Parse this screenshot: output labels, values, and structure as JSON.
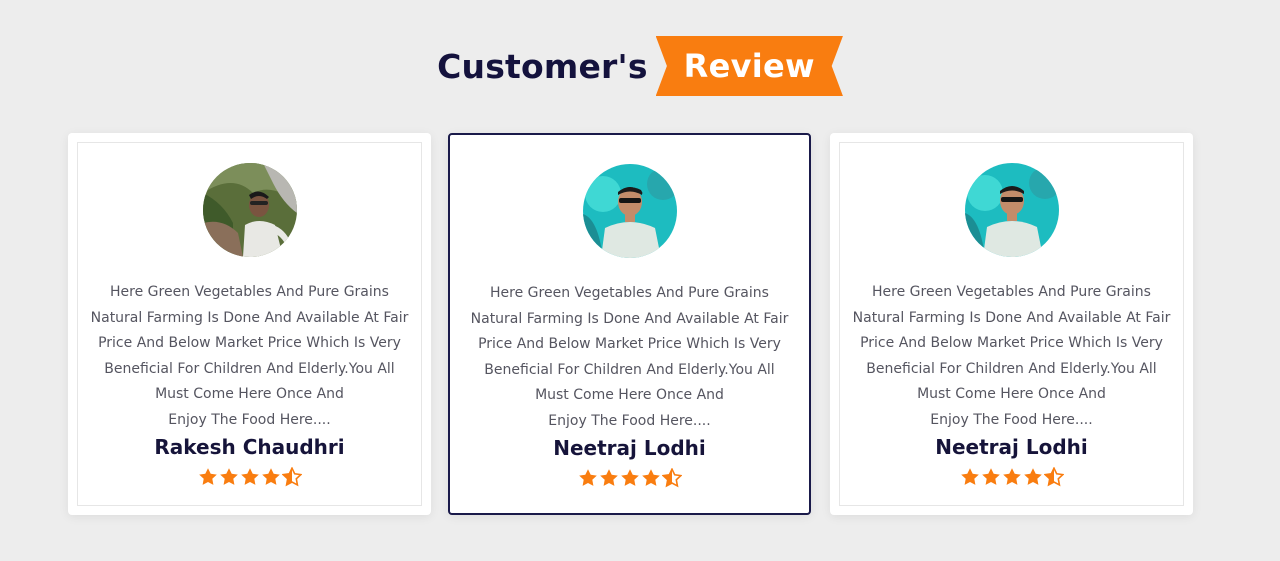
{
  "section": {
    "title_main": "Customer's",
    "title_highlight": "Review",
    "accent_color": "#f97d10",
    "title_color": "#14123d"
  },
  "reviews": [
    {
      "avatar_icon": "customer-photo",
      "review_lines": [
        "Here Green Vegetables And Pure Grains",
        "Natural Farming Is Done And Available At Fair",
        "Price And Below Market Price Which Is Very",
        "Beneficial For Children And Elderly.You All",
        "Must Come Here Once And",
        "Enjoy The Food Here...."
      ],
      "name": "Rakesh Chaudhri",
      "rating": 4.5
    },
    {
      "avatar_icon": "customer-photo",
      "review_lines": [
        "Here Green Vegetables And Pure Grains",
        "Natural Farming Is Done And Available At Fair",
        "Price And Below Market Price Which Is Very",
        "Beneficial For Children And Elderly.You All",
        "Must Come Here Once And",
        "Enjoy The Food Here...."
      ],
      "name": "Neetraj Lodhi",
      "rating": 4.5,
      "active": true
    },
    {
      "avatar_icon": "customer-photo",
      "review_lines": [
        "Here Green Vegetables And Pure Grains",
        "Natural Farming Is Done And Available At Fair",
        "Price And Below Market Price Which Is Very",
        "Beneficial For Children And Elderly.You All",
        "Must Come Here Once And",
        "Enjoy The Food Here...."
      ],
      "name": "Neetraj Lodhi",
      "rating": 4.5
    }
  ]
}
